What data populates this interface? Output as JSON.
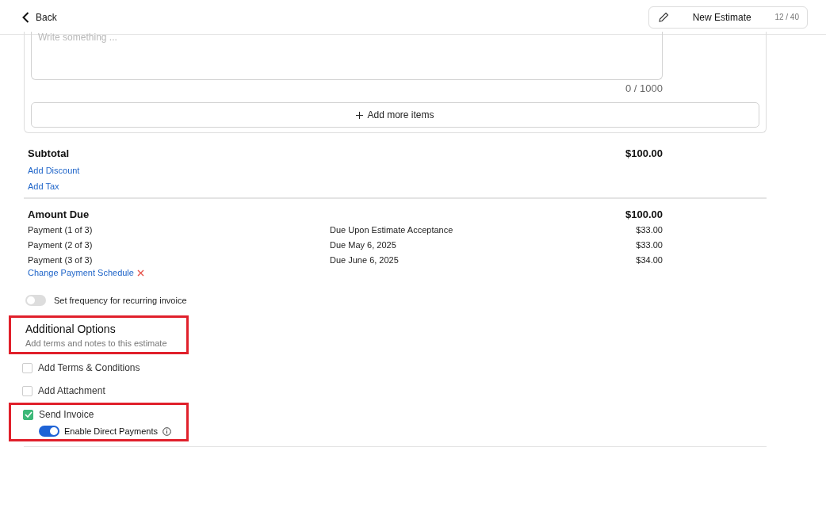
{
  "header": {
    "back": "Back",
    "title": "New Estimate",
    "counter": "12 / 40"
  },
  "notes": {
    "placeholder": "Write something ...",
    "count": "0 / 1000"
  },
  "add_items": "Add more items",
  "subtotal": {
    "label": "Subtotal",
    "value": "$100.00",
    "links": [
      "Add Discount",
      "Add Tax"
    ]
  },
  "amount_due": {
    "label": "Amount Due",
    "value": "$100.00"
  },
  "payments": [
    {
      "name": "Payment (1 of 3)",
      "due": "Due Upon Estimate Acceptance",
      "amount": "$33.00"
    },
    {
      "name": "Payment (2 of 3)",
      "due": "Due May 6, 2025",
      "amount": "$33.00"
    },
    {
      "name": "Payment (3 of 3)",
      "due": "Due June 6, 2025",
      "amount": "$34.00"
    }
  ],
  "change_schedule": "Change Payment Schedule",
  "recurring": {
    "label": "Set frequency for recurring invoice",
    "on": false
  },
  "additional_options": {
    "title": "Additional Options",
    "subtitle": "Add terms and notes to this estimate",
    "highlighted": true
  },
  "options": [
    {
      "label": "Add Terms & Conditions",
      "checked": false
    },
    {
      "label": "Add Attachment",
      "checked": false
    },
    {
      "label": "Send Invoice",
      "checked": true,
      "highlighted": true,
      "sub_toggle": {
        "label": "Enable Direct Payments",
        "on": true
      }
    }
  ]
}
